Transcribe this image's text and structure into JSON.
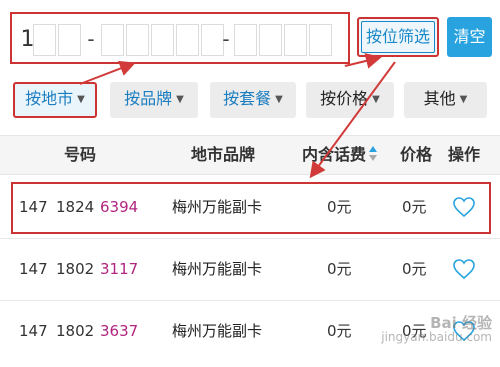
{
  "number_input": {
    "first_digit": "1",
    "separator": "-"
  },
  "buttons": {
    "filter_label": "按位筛选",
    "clear_label": "清空"
  },
  "dropdowns": [
    {
      "label": "按地市"
    },
    {
      "label": "按品牌"
    },
    {
      "label": "按套餐"
    },
    {
      "label": "按价格"
    },
    {
      "label": "其他"
    }
  ],
  "table": {
    "headers": {
      "number": "号码",
      "brand": "地市品牌",
      "fee": "内含话费",
      "price": "价格",
      "action": "操作"
    },
    "rows": [
      {
        "p1": "147",
        "p2": "1824",
        "p3": "6394",
        "brand": "梅州万能副卡",
        "fee": "0元",
        "price": "0元"
      },
      {
        "p1": "147",
        "p2": "1802",
        "p3": "3117",
        "brand": "梅州万能副卡",
        "fee": "0元",
        "price": "0元"
      },
      {
        "p1": "147",
        "p2": "1802",
        "p3": "3637",
        "brand": "梅州万能副卡",
        "fee": "0元",
        "price": "0元"
      }
    ]
  },
  "watermark": {
    "line1": "Bai 经验",
    "line2": "jingyan.baidu.com"
  },
  "colors": {
    "accent": "#29a3e0",
    "highlight_outline": "#cc3333",
    "number_highlight": "#b0257f"
  },
  "icons": {
    "favorite": "heart-outline-icon",
    "dropdown": "caret-down-icon",
    "sort": "sort-icon"
  }
}
